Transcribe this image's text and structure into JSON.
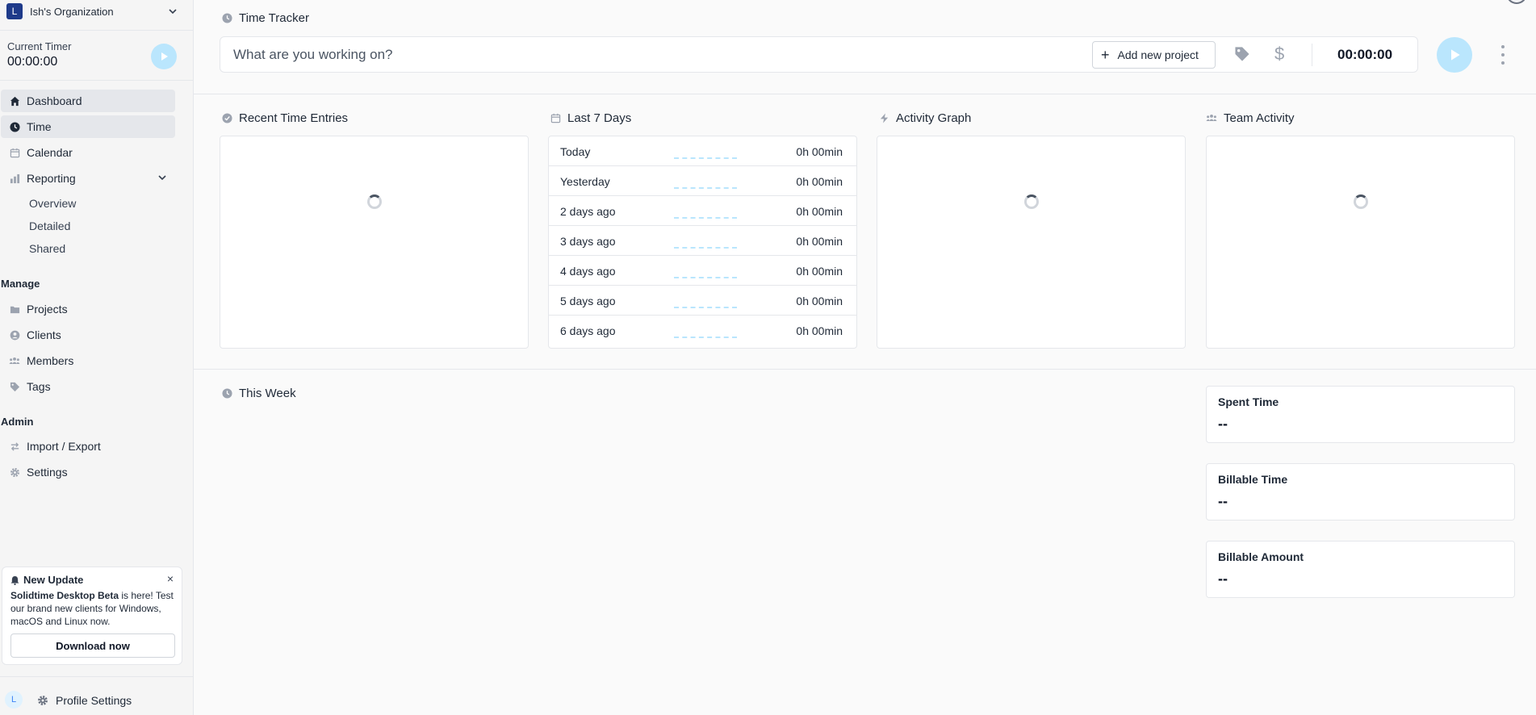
{
  "org": {
    "logo_letter": "L",
    "name": "Ish's Organization"
  },
  "current_timer": {
    "label": "Current Timer",
    "value": "00:00:00"
  },
  "nav": {
    "dashboard": "Dashboard",
    "time": "Time",
    "calendar": "Calendar",
    "reporting": "Reporting",
    "reporting_sub": [
      "Overview",
      "Detailed",
      "Shared"
    ],
    "manage_heading": "Manage",
    "projects": "Projects",
    "clients": "Clients",
    "members": "Members",
    "tags": "Tags",
    "admin_heading": "Admin",
    "import_export": "Import / Export",
    "settings": "Settings"
  },
  "update": {
    "title": "New Update",
    "close": "×",
    "product": "Solidtime Desktop Beta",
    "text_after": " is here! Test our brand new clients for Windows, macOS and Linux now.",
    "button": "Download now"
  },
  "profile": {
    "avatar_letter": "L",
    "label": "Profile Settings"
  },
  "tracker": {
    "title": "Time Tracker",
    "placeholder": "What are you working on?",
    "add_project": "Add new project",
    "time": "00:00:00"
  },
  "sections": {
    "recent": "Recent Time Entries",
    "last7": "Last 7 Days",
    "activity": "Activity Graph",
    "team": "Team Activity",
    "this_week": "This Week"
  },
  "last7_days": [
    {
      "label": "Today",
      "value": "0h 00min"
    },
    {
      "label": "Yesterday",
      "value": "0h 00min"
    },
    {
      "label": "2 days ago",
      "value": "0h 00min"
    },
    {
      "label": "3 days ago",
      "value": "0h 00min"
    },
    {
      "label": "4 days ago",
      "value": "0h 00min"
    },
    {
      "label": "5 days ago",
      "value": "0h 00min"
    },
    {
      "label": "6 days ago",
      "value": "0h 00min"
    }
  ],
  "stats": [
    {
      "label": "Spent Time",
      "value": "--"
    },
    {
      "label": "Billable Time",
      "value": "--"
    },
    {
      "label": "Billable Amount",
      "value": "--"
    }
  ],
  "colors": {
    "accent_light": "#bae6fd",
    "org_logo": "#1e3a8a",
    "active_nav": "#e5e7eb"
  }
}
